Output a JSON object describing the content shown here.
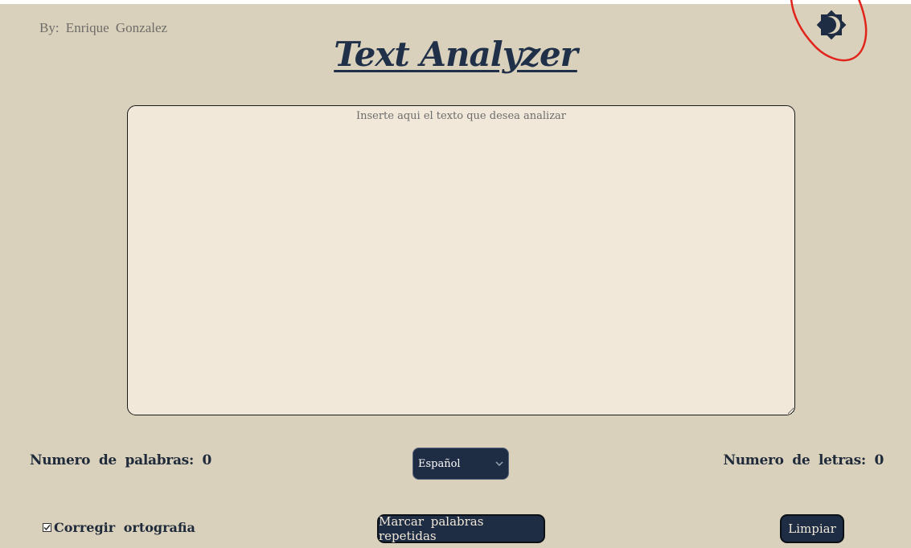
{
  "header": {
    "author": "By: Enrique Gonzalez",
    "title": "Text Analyzer"
  },
  "theme_toggle": {
    "icon": "moon-sun-icon",
    "mode": "dark"
  },
  "editor": {
    "placeholder": "Inserte aqui el texto que desea analizar",
    "value": ""
  },
  "stats": {
    "words_label": "Numero de palabras:",
    "words_value": "0",
    "letters_label": "Numero de letras:",
    "letters_value": "0"
  },
  "language": {
    "selected": "Español"
  },
  "options": {
    "spellcheck_label": "Corregir ortografia",
    "spellcheck_checked": true
  },
  "actions": {
    "mark_repeated_label": "Marcar palabras repetidas",
    "clear_label": "Limpiar"
  },
  "colors": {
    "background": "#dad1bc",
    "panel": "#f1e8d9",
    "primary_dark": "#1e2d44",
    "annotation_red": "#e0241b"
  }
}
